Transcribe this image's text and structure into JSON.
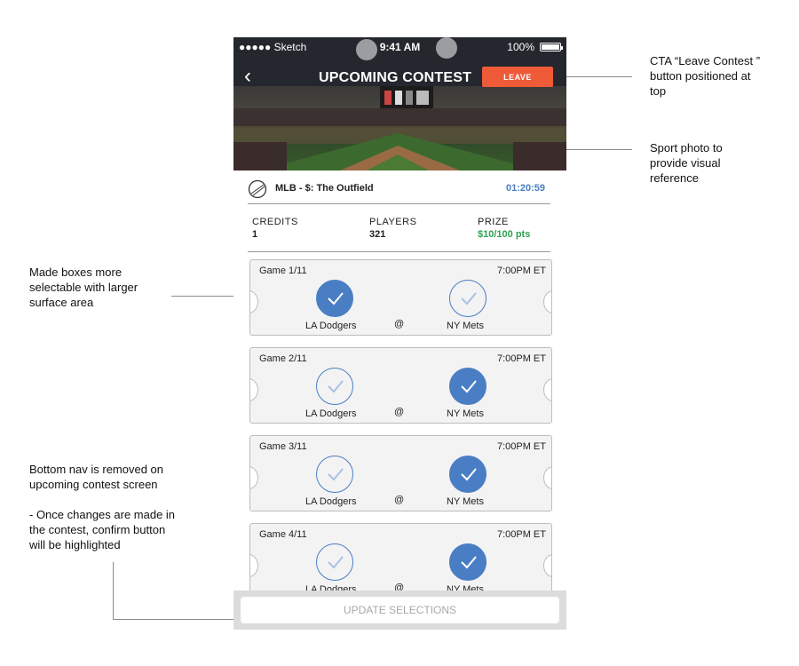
{
  "status_bar": {
    "carrier": "●●●●● Sketch",
    "time": "9:41 AM",
    "battery": "100%"
  },
  "header": {
    "title": "UPCOMING CONTEST",
    "leave_label": "LEAVE"
  },
  "contest": {
    "name": "MLB - $: The Outfield",
    "countdown": "01:20:59"
  },
  "stats": [
    {
      "label": "CREDITS",
      "value": "1",
      "color": "#222222"
    },
    {
      "label": "PLAYERS",
      "value": "321",
      "color": "#222222"
    },
    {
      "label": "PRIZE",
      "value": "$10/100 pts",
      "color": "#2ea352"
    }
  ],
  "games": [
    {
      "number": "Game 1/11",
      "time": "7:00PM ET",
      "away": "LA Dodgers",
      "home": "NY Mets",
      "at": "@",
      "selected": "away"
    },
    {
      "number": "Game 2/11",
      "time": "7:00PM ET",
      "away": "LA Dodgers",
      "home": "NY Mets",
      "at": "@",
      "selected": "home"
    },
    {
      "number": "Game 3/11",
      "time": "7:00PM ET",
      "away": "LA Dodgers",
      "home": "NY Mets",
      "at": "@",
      "selected": "home"
    },
    {
      "number": "Game 4/11",
      "time": "7:00PM ET",
      "away": "LA Dodgers",
      "home": "NY Mets",
      "at": "@",
      "selected": "home"
    }
  ],
  "footer": {
    "update_label": "UPDATE SELECTIONS"
  },
  "annotations": {
    "cta": "CTA “Leave Contest ”\nbutton positioned at\ntop",
    "photo": "Sport photo to\nprovide visual\nreference",
    "boxes": "Made boxes more\nselectable with larger\nsurface area",
    "nav": "Bottom nav is removed on\nupcoming contest screen\n\n- Once changes are made in\nthe contest, confirm button\nwill be highlighted"
  },
  "colors": {
    "accent": "#4a7ec4",
    "leave": "#ef5a38",
    "prize": "#2ea352"
  }
}
